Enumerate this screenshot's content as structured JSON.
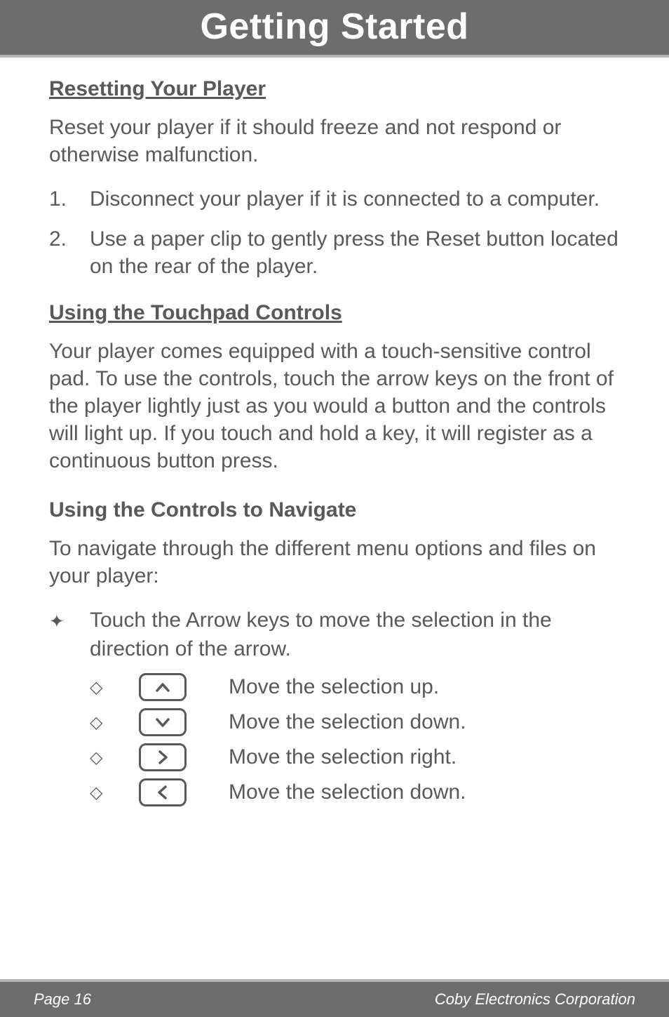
{
  "header": {
    "title": "Getting Started"
  },
  "content": {
    "section1": {
      "title": "Resetting Your Player",
      "para": "Reset your player if it should freeze and not respond or otherwise malfunction.",
      "steps": [
        {
          "num": "1.",
          "text": "Disconnect your player if it is connected to a computer."
        },
        {
          "num": "2.",
          "text": "Use a paper clip to gently press the Reset button located on the rear of the player."
        }
      ]
    },
    "section2": {
      "title": "Using the Touchpad Controls",
      "para": "Your player comes equipped with a touch-sensitive control pad. To use the controls, touch the arrow keys on the front of the player lightly just as you would a button and the controls will light up. If you touch and hold a key, it will register as a continuous button press."
    },
    "section3": {
      "title": "Using the Controls to Navigate",
      "para": "To navigate through the different menu options and files on your player:",
      "bullet": "Touch the Arrow keys to move the selection in the direction of the arrow.",
      "keys": [
        {
          "symbol": "⌃",
          "text": "Move the selection up."
        },
        {
          "symbol": "⌄",
          "text": "Move the selection down."
        },
        {
          "symbol": "›",
          "text": "Move the selection right."
        },
        {
          "symbol": "‹",
          "text": "Move the selection down."
        }
      ]
    }
  },
  "footer": {
    "page": "Page 16",
    "org": "Coby Electronics Corporation"
  }
}
